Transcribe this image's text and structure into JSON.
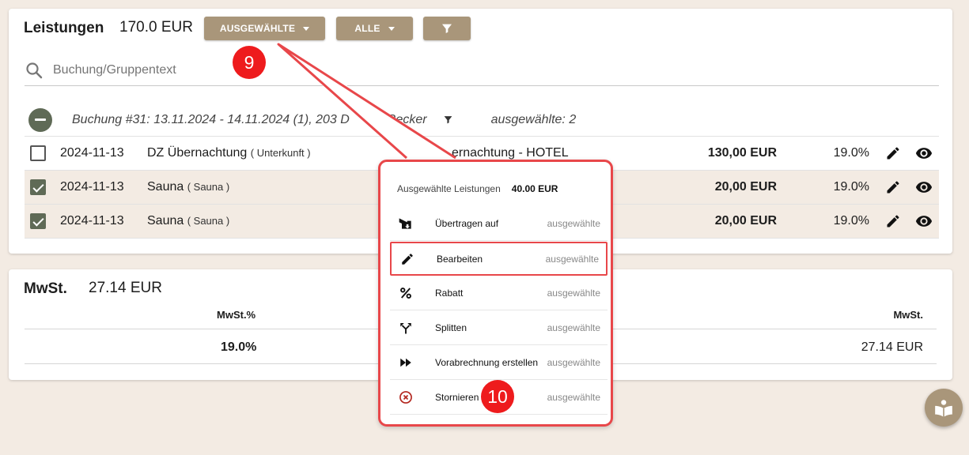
{
  "leistungen": {
    "title": "Leistungen",
    "total": "170.0 EUR",
    "btn_selected": "AUSGEWÄHLTE",
    "btn_all": "ALLE",
    "search_placeholder": "Buchung/Gruppentext",
    "group": {
      "text": "Buchung #31: 13.11.2024 - 14.11.2024 (1), 203 D",
      "text_tail": "Becker",
      "selected_count": "ausgewählte: 2"
    },
    "rows": [
      {
        "checked": false,
        "date": "2024-11-13",
        "name": "DZ Übernachtung",
        "category": "( Unterkunft )",
        "dept": "ernachtung - HOTEL",
        "price": "130,00 EUR",
        "vat": "19.0%"
      },
      {
        "checked": true,
        "date": "2024-11-13",
        "name": "Sauna",
        "category": "( Sauna )",
        "dept": "",
        "price": "20,00 EUR",
        "vat": "19.0%"
      },
      {
        "checked": true,
        "date": "2024-11-13",
        "name": "Sauna",
        "category": "( Sauna )",
        "dept": "",
        "price": "20,00 EUR",
        "vat": "19.0%"
      }
    ]
  },
  "mwst": {
    "title": "MwSt.",
    "total": "27.14 EUR",
    "col_rate": "MwSt.%",
    "col_amount": "MwSt.",
    "rate": "19.0%",
    "amount": "27.14 EUR"
  },
  "popup": {
    "title": "Ausgewählte Leistungen",
    "amount": "40.00 EUR",
    "items": [
      {
        "label": "Übertragen auf",
        "scope": "ausgewählte",
        "icon": "transfer-icon"
      },
      {
        "label": "Bearbeiten",
        "scope": "ausgewählte",
        "icon": "pencil-icon"
      },
      {
        "label": "Rabatt",
        "scope": "ausgewählte",
        "icon": "percent-icon"
      },
      {
        "label": "Splitten",
        "scope": "ausgewählte",
        "icon": "split-icon"
      },
      {
        "label": "Vorabrechnung erstellen",
        "scope": "ausgewählte",
        "icon": "fast-forward-icon"
      },
      {
        "label": "Stornieren",
        "scope": "ausgewählte",
        "icon": "cancel-icon"
      }
    ]
  },
  "annotations": {
    "badge_9": "9",
    "badge_10": "10"
  },
  "colors": {
    "accent": "#a9967a",
    "highlight": "#e8474a",
    "badge": "#ee1b1d",
    "selected_row": "#f3ebe3"
  }
}
